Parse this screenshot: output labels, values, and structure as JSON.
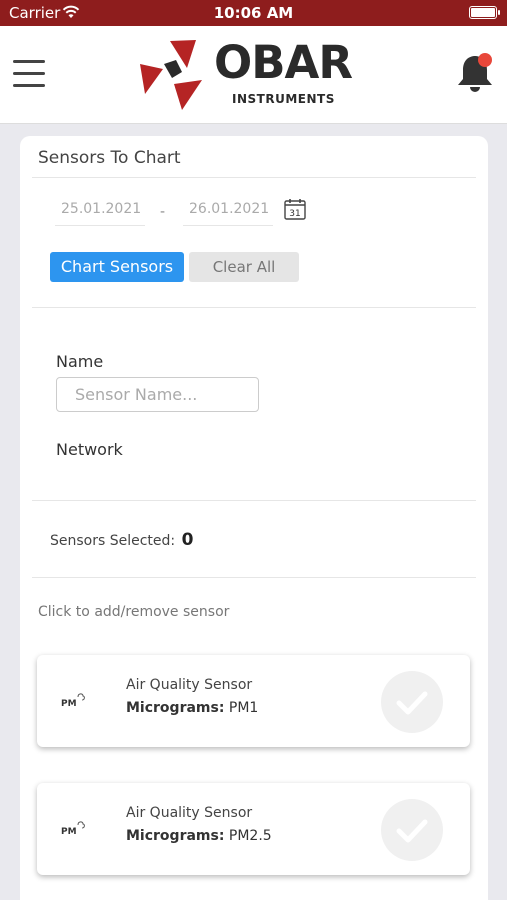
{
  "status_bar": {
    "carrier": "Carrier",
    "time": "10:06 AM"
  },
  "header": {
    "logo_word": "OBAR",
    "logo_sub": "INSTRUMENTS"
  },
  "panel": {
    "title": "Sensors To Chart",
    "date_from": "25.01.2021",
    "date_sep": "-",
    "date_to": "26.01.2021",
    "calendar_day": "31",
    "chart_button": "Chart Sensors",
    "clear_button": "Clear All",
    "name_label": "Name",
    "name_placeholder": "Sensor Name...",
    "network_label": "Network",
    "selected_label": "Sensors Selected:",
    "selected_count": "0",
    "hint": "Click to add/remove sensor"
  },
  "sensors": [
    {
      "title": "Air Quality Sensor",
      "unit_label": "Micrograms:",
      "value": "PM1",
      "icon_text": "PM"
    },
    {
      "title": "Air Quality Sensor",
      "unit_label": "Micrograms:",
      "value": "PM2.5",
      "icon_text": "PM"
    }
  ],
  "colors": {
    "status_bar": "#8e1d1d",
    "logo_red": "#b52424",
    "accent_blue": "#2d95ef",
    "bell_badge": "#e8473a"
  }
}
